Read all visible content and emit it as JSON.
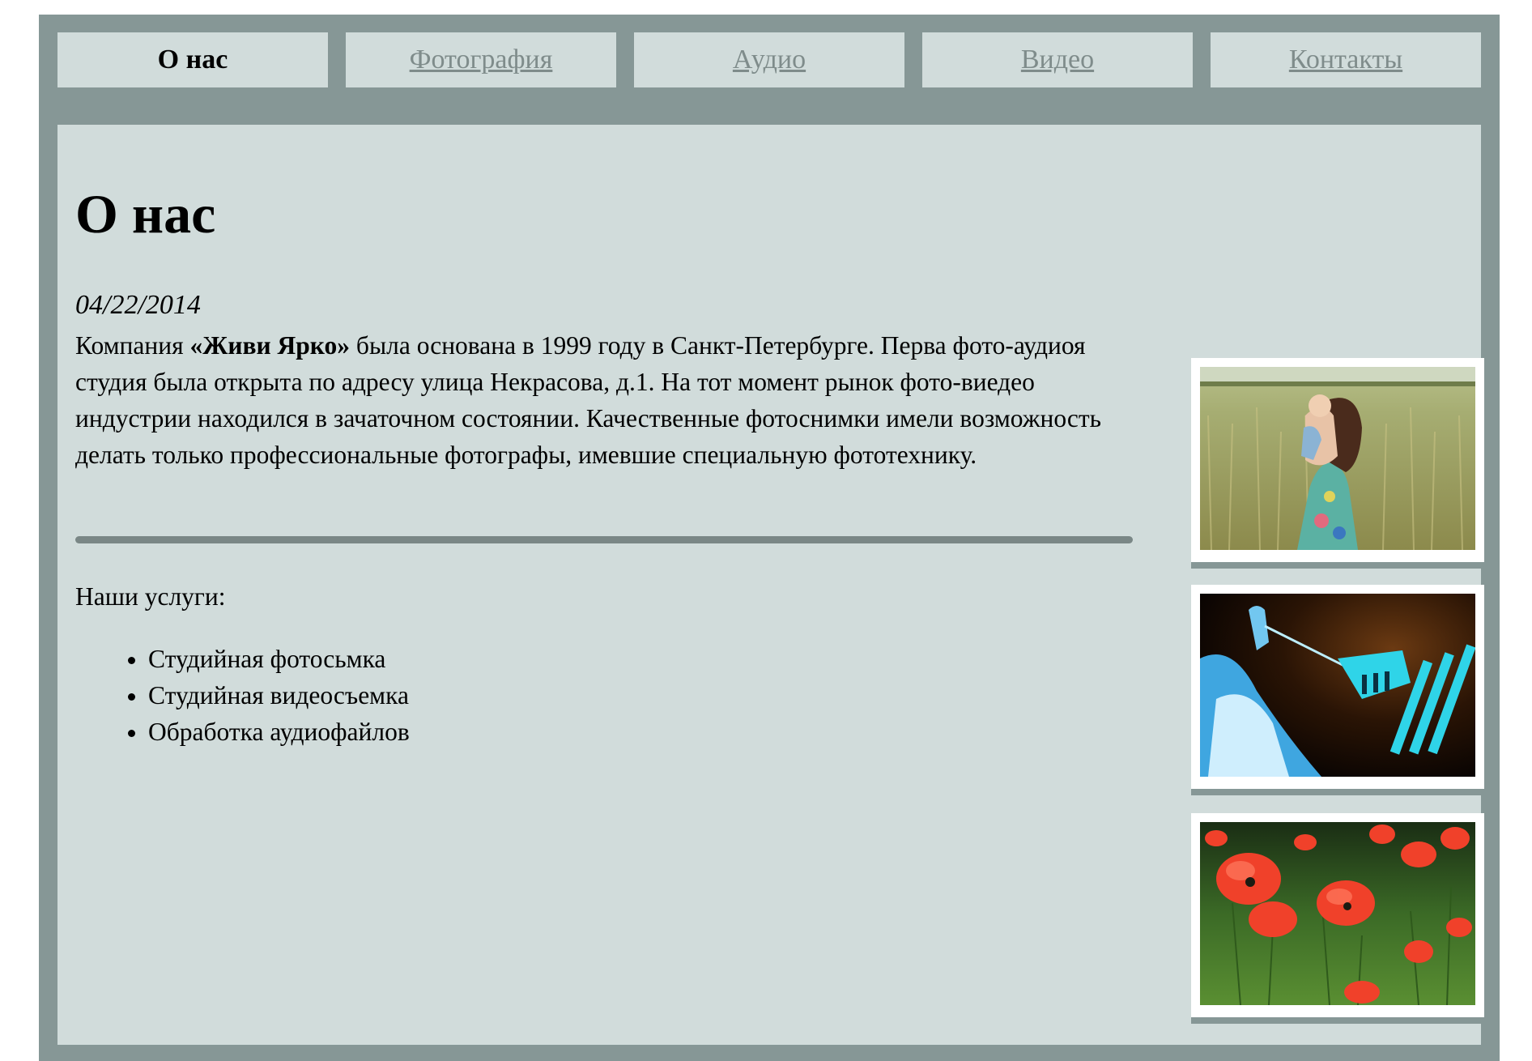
{
  "nav": {
    "items": [
      {
        "label": "О нас",
        "active": true
      },
      {
        "label": "Фотография",
        "active": false
      },
      {
        "label": "Аудио",
        "active": false
      },
      {
        "label": "Видео",
        "active": false
      },
      {
        "label": "Контакты",
        "active": false
      }
    ]
  },
  "main": {
    "title": "О нас",
    "date": "04/22/2014",
    "paragraph": {
      "prefix": "Компания ",
      "company": "«Живи Ярко»",
      "text": " была основана в 1999 году в Санкт-Петербурге. Перва фото-аудиоя студия была открыта по адресу улица Некрасова, д.1. На тот момент рынок фото-виедео индустрии находился в зачаточном состоянии. Качественные фотоснимки имели возможность делать только профессиональные фотографы, имевшие специальную фототехнику."
    },
    "services_label": "Наши услуги:",
    "services": [
      "Студийная фотосьмка",
      "Студийная видеосъемка",
      "Обработка аудиофайлов"
    ]
  },
  "colors": {
    "frame": "#869796",
    "panel": "#d1dcdb",
    "link": "#7f8c8b",
    "divider": "#7a8786"
  },
  "gallery": [
    "woman-with-child-in-field-photo",
    "musician-blue-light-photo",
    "red-poppies-photo"
  ]
}
